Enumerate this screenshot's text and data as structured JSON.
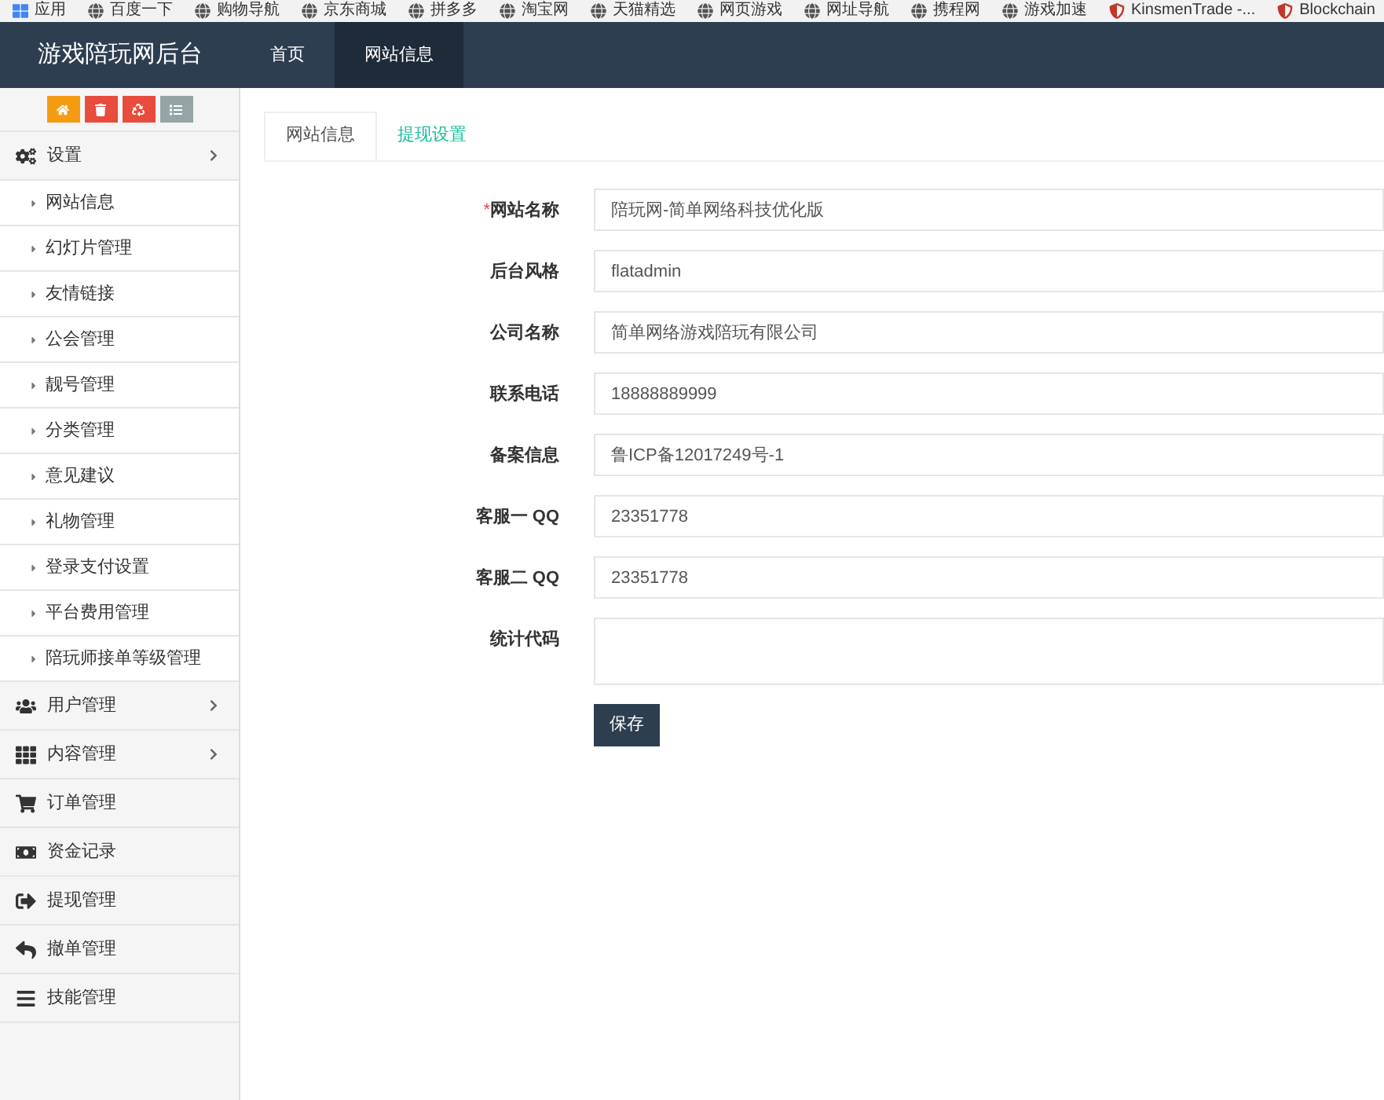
{
  "bookmarks": [
    {
      "label": "应用",
      "kind": "apps"
    },
    {
      "label": "百度一下",
      "kind": "site"
    },
    {
      "label": "购物导航",
      "kind": "site"
    },
    {
      "label": "京东商城",
      "kind": "site"
    },
    {
      "label": "拼多多",
      "kind": "site"
    },
    {
      "label": "淘宝网",
      "kind": "site"
    },
    {
      "label": "天猫精选",
      "kind": "site"
    },
    {
      "label": "网页游戏",
      "kind": "site"
    },
    {
      "label": "网址导航",
      "kind": "site"
    },
    {
      "label": "携程网",
      "kind": "site"
    },
    {
      "label": "游戏加速",
      "kind": "site"
    },
    {
      "label": "KinsmenTrade -...",
      "kind": "shield"
    },
    {
      "label": "Blockchain",
      "kind": "shield"
    }
  ],
  "header": {
    "title": "游戏陪玩网后台",
    "nav": [
      {
        "label": "首页",
        "selected": false
      },
      {
        "label": "网站信息",
        "selected": true
      }
    ]
  },
  "sidebar": {
    "items": [
      {
        "label": "设置",
        "kind": "group",
        "children": [
          {
            "label": "网站信息"
          },
          {
            "label": "幻灯片管理"
          },
          {
            "label": "友情链接"
          },
          {
            "label": "公会管理"
          },
          {
            "label": "靓号管理"
          },
          {
            "label": "分类管理"
          },
          {
            "label": "意见建议"
          },
          {
            "label": "礼物管理"
          },
          {
            "label": "登录支付设置"
          },
          {
            "label": "平台费用管理"
          },
          {
            "label": "陪玩师接单等级管理"
          }
        ]
      },
      {
        "label": "用户管理",
        "kind": "group"
      },
      {
        "label": "内容管理",
        "kind": "group"
      },
      {
        "label": "订单管理",
        "kind": "link"
      },
      {
        "label": "资金记录",
        "kind": "link"
      },
      {
        "label": "提现管理",
        "kind": "link"
      },
      {
        "label": "撤单管理",
        "kind": "link"
      },
      {
        "label": "技能管理",
        "kind": "link"
      }
    ]
  },
  "tabs": [
    {
      "label": "网站信息",
      "selected": true
    },
    {
      "label": "提现设置",
      "selected": false
    }
  ],
  "form": {
    "fields": [
      {
        "label": "网站名称",
        "marker": "*",
        "kind": "input",
        "value": "陪玩网-简单网络科技优化版"
      },
      {
        "label": "后台风格",
        "kind": "input",
        "value": "flatadmin"
      },
      {
        "label": "公司名称",
        "kind": "input",
        "value": "简单网络游戏陪玩有限公司"
      },
      {
        "label": "联系电话",
        "kind": "input",
        "value": "18888889999"
      },
      {
        "label": "备案信息",
        "kind": "input",
        "value": "鲁ICP备12017249号-1"
      },
      {
        "label": "客服一 QQ",
        "kind": "input",
        "value": "23351778"
      },
      {
        "label": "客服二 QQ",
        "kind": "input",
        "value": "23351778"
      },
      {
        "label": "统计代码",
        "kind": "textarea"
      }
    ],
    "submit": "保存"
  }
}
